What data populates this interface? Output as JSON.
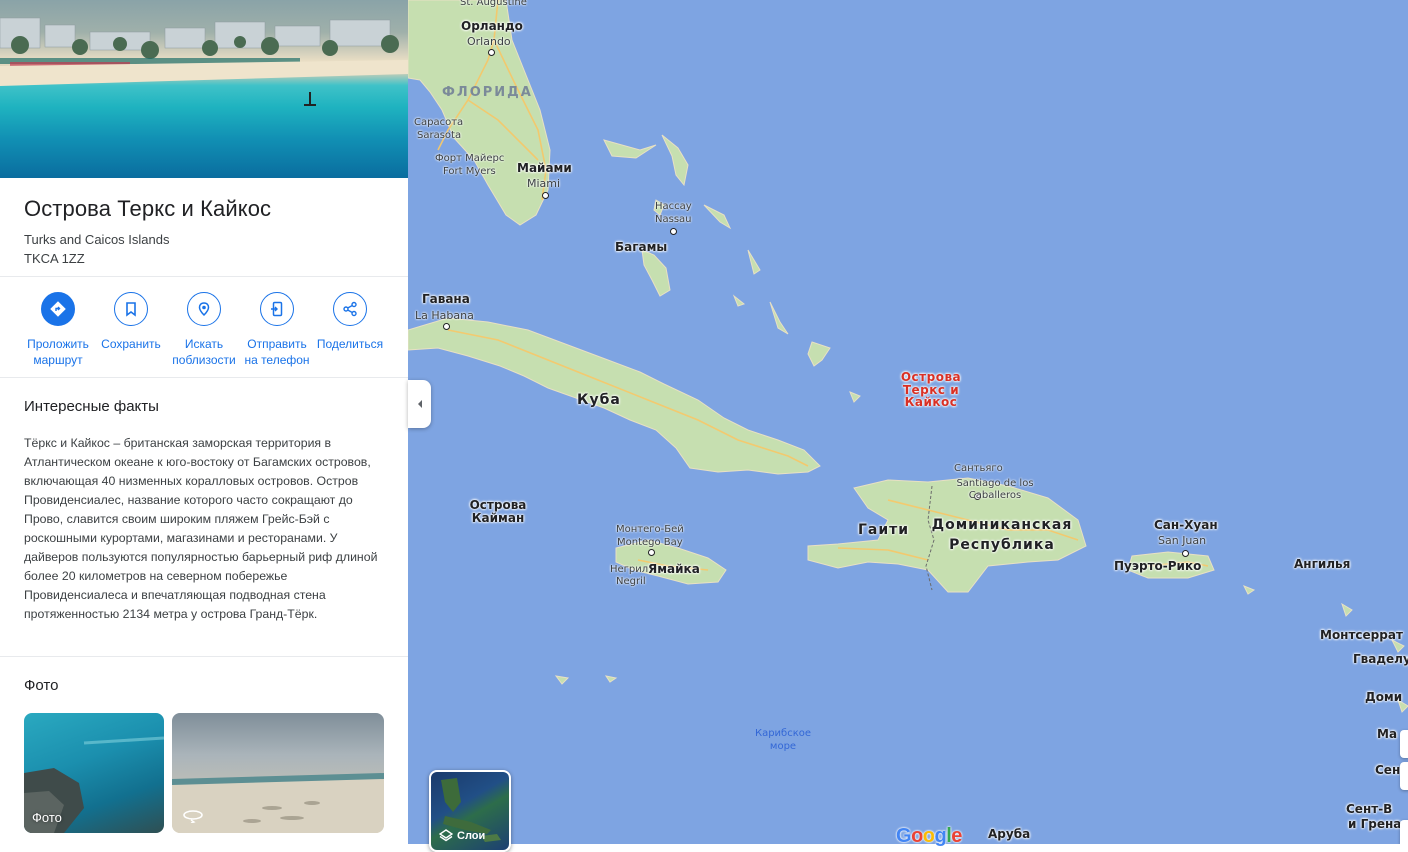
{
  "place": {
    "title": "Острова Теркс и Кайкос",
    "name_en": "Turks and Caicos Islands",
    "postcode": "TKCA 1ZZ"
  },
  "actions": [
    {
      "label": "Проложить маршрут",
      "icon": "directions-icon"
    },
    {
      "label": "Сохранить",
      "icon": "bookmark-icon"
    },
    {
      "label": "Искать поблизости",
      "icon": "nearby-icon"
    },
    {
      "label": "Отправить на телефон",
      "icon": "send-to-phone-icon"
    },
    {
      "label": "Поделиться",
      "icon": "share-icon"
    }
  ],
  "facts": {
    "title": "Интересные факты",
    "text": "Тёркс и Кайкос – британская заморская территория в Атлантическом океане к юго-востоку от Багамских островов, включающая 40 низменных коралловых островов. Остров Провиденсиалес, название которого часто сокращают до Прово, славится своим широким пляжем Грейс-Бэй с роскошными курортами, магазинами и ресторанами. У дайверов пользуются популярностью барьерный риф длиной более 20 километров на северном побережье Провиденсиалеса и впечатляющая подводная стена протяженностью 2134 метра у острова Гранд-Тёрк."
  },
  "photos": {
    "title": "Фото",
    "items": [
      {
        "label": "Фото"
      },
      {
        "label": "",
        "icon": "360-icon"
      }
    ]
  },
  "map": {
    "layers_label": "Слои",
    "logo": "Google",
    "colors": {
      "water": "#7ea4e2",
      "land": "#c6dfb0",
      "road": "#f5c86b",
      "highlight": "#d93025"
    },
    "labels": {
      "st_augustine": "St. Augustine",
      "orlando_ru": "Орландо",
      "orlando_en": "Orlando",
      "florida": "ФЛОРИДА",
      "sarasota_ru": "Сарасота",
      "sarasota_en": "Sarasota",
      "fort_myers_ru": "Форт Майерс",
      "fort_myers_en": "Fort Myers",
      "miami_ru": "Майами",
      "miami_en": "Miami",
      "nassau_ru": "Нассау",
      "nassau_en": "Nassau",
      "bahamas": "Багамы",
      "havana_ru": "Гавана",
      "havana_en": "La Habana",
      "cuba": "Куба",
      "turks": "Острова Теркс и Кайкос",
      "cayman": "Острова Кайман",
      "montego_ru": "Монтего-Бей",
      "montego_en": "Montego Bay",
      "negril_ru": "Негрил",
      "negril_en": "Negril",
      "jamaica": "Ямайка",
      "haiti": "Гаити",
      "dominican": "Доминиканская Республика",
      "santiago_ru": "Сантьяго",
      "santiago_en": "Santiago de los Caballeros",
      "san_juan_ru": "Сан-Хуан",
      "san_juan_en": "San Juan",
      "puerto_rico": "Пуэрто-Рико",
      "anguilla": "Ангилья",
      "montserrat": "Монтсеррат",
      "guadeloupe": "Гваделу",
      "dominica": "Доми",
      "martinique": "Ма",
      "st_lucia": "Сен",
      "st_vincent_1": "Сент-В",
      "st_vincent_2": "и Грена",
      "caribbean_sea": "Карибское море",
      "aruba": "Аруба"
    }
  }
}
